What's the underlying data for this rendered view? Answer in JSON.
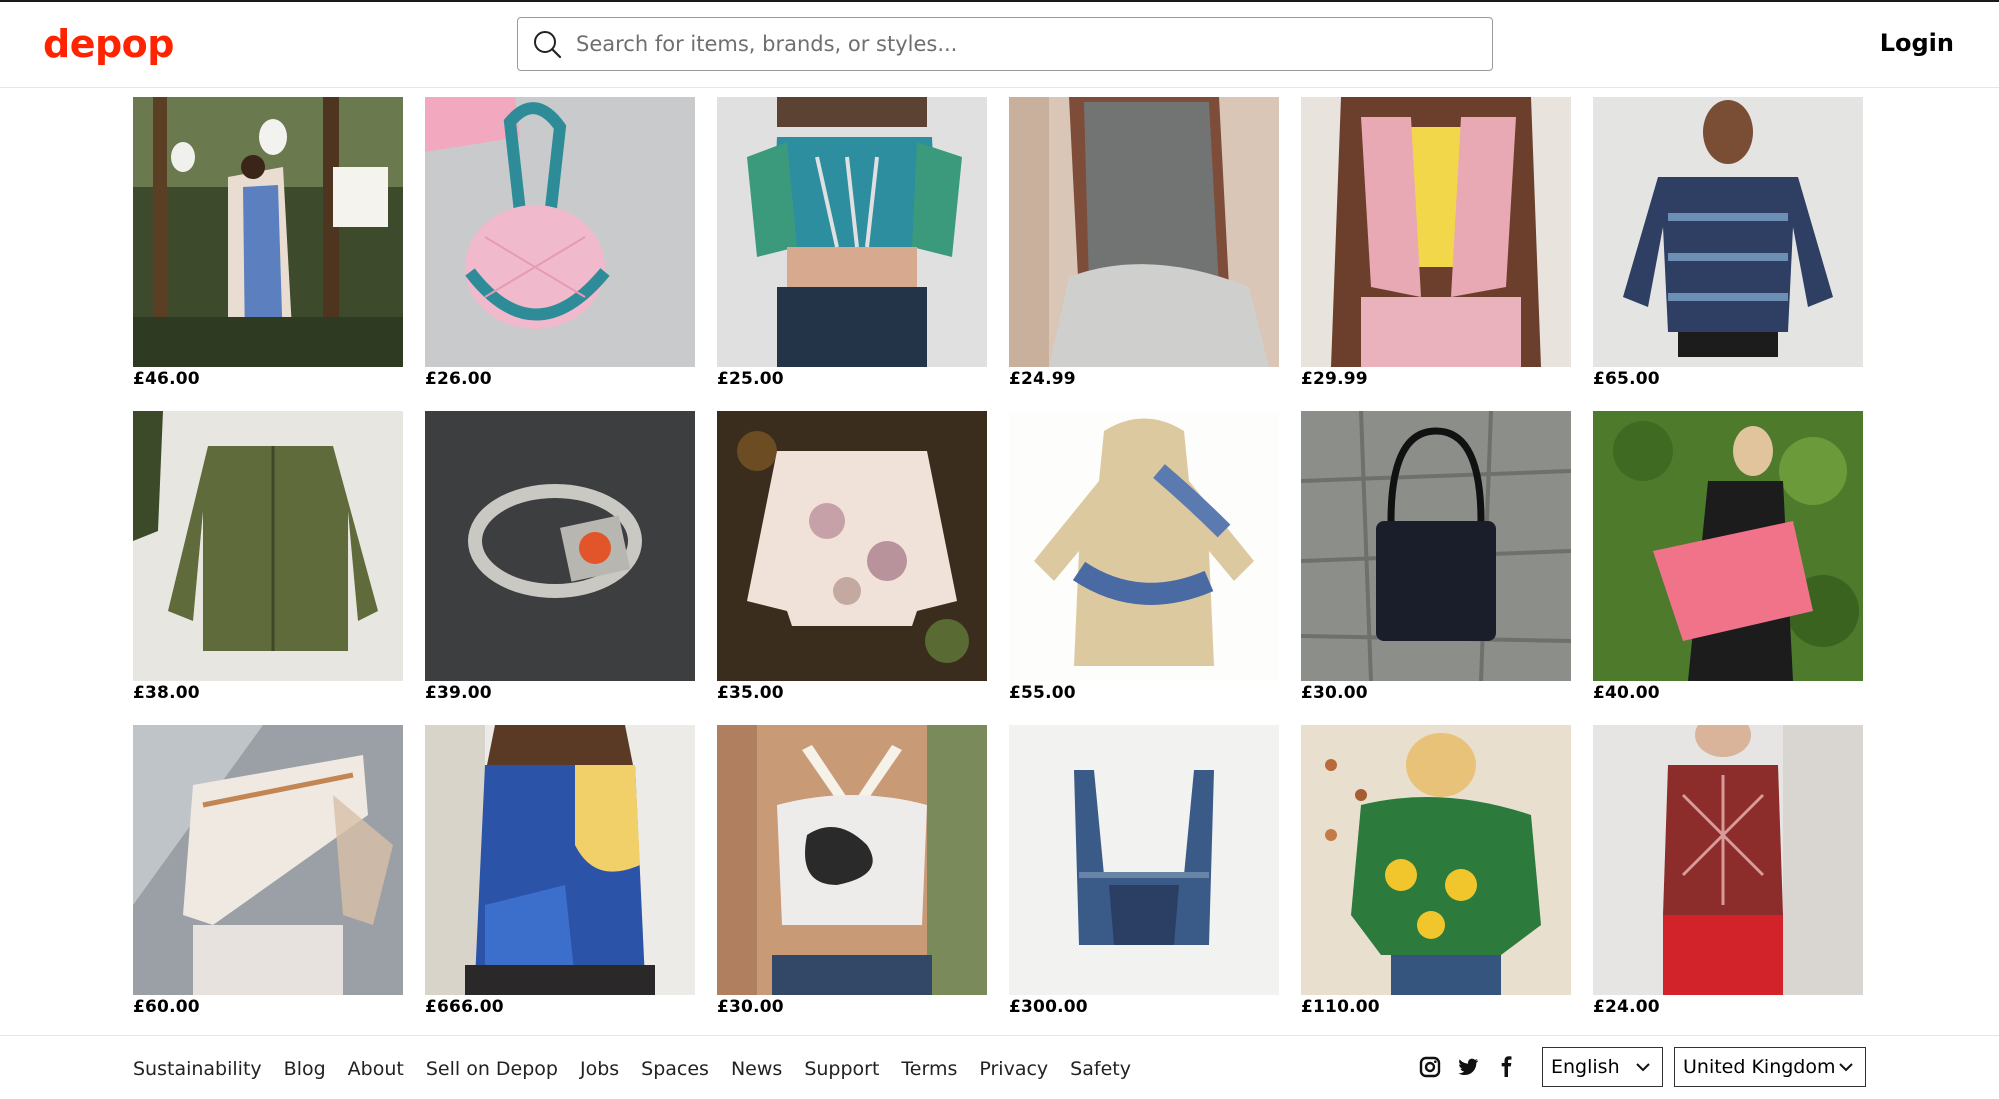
{
  "header": {
    "logo": "depop",
    "search_placeholder": "Search for items, brands, or styles...",
    "login_label": "Login"
  },
  "products": [
    {
      "price": "£46.00",
      "image": "woman in denim jumpsuit in forest"
    },
    {
      "price": "£26.00",
      "image": "pink quilted round bag"
    },
    {
      "price": "£25.00",
      "image": "printed cut-out crop top"
    },
    {
      "price": "£24.99",
      "image": "grey tank top"
    },
    {
      "price": "£29.99",
      "image": "pink and yellow lettuce-edge top"
    },
    {
      "price": "£65.00",
      "image": "patterned knit jumper"
    },
    {
      "price": "£38.00",
      "image": "olive quilted liner jacket"
    },
    {
      "price": "£39.00",
      "image": "silver ring with orange stone"
    },
    {
      "price": "£35.00",
      "image": "floral cropped jacket"
    },
    {
      "price": "£55.00",
      "image": "tie-dye hoodie"
    },
    {
      "price": "£30.00",
      "image": "navy shoulder bag"
    },
    {
      "price": "£40.00",
      "image": "pink leopard fluffy bag"
    },
    {
      "price": "£60.00",
      "image": "white lace-up top with sheer sleeves"
    },
    {
      "price": "£666.00",
      "image": "blue printed maxi skirt"
    },
    {
      "price": "£30.00",
      "image": "spray painted halter top"
    },
    {
      "price": "£300.00",
      "image": "patchwork denim bustier"
    },
    {
      "price": "£110.00",
      "image": "green crochet sunflower cardigan"
    },
    {
      "price": "£24.00",
      "image": "red printed sleeveless top"
    }
  ],
  "footer": {
    "links": [
      "Sustainability",
      "Blog",
      "About",
      "Sell on Depop",
      "Jobs",
      "Spaces",
      "News",
      "Support",
      "Terms",
      "Privacy",
      "Safety"
    ],
    "social_icons": [
      "instagram-icon",
      "twitter-icon",
      "facebook-icon"
    ],
    "language": "English",
    "country": "United Kingdom"
  },
  "colors": {
    "brand": "#ff2300",
    "text": "#000000",
    "border": "#9b9b9b"
  }
}
